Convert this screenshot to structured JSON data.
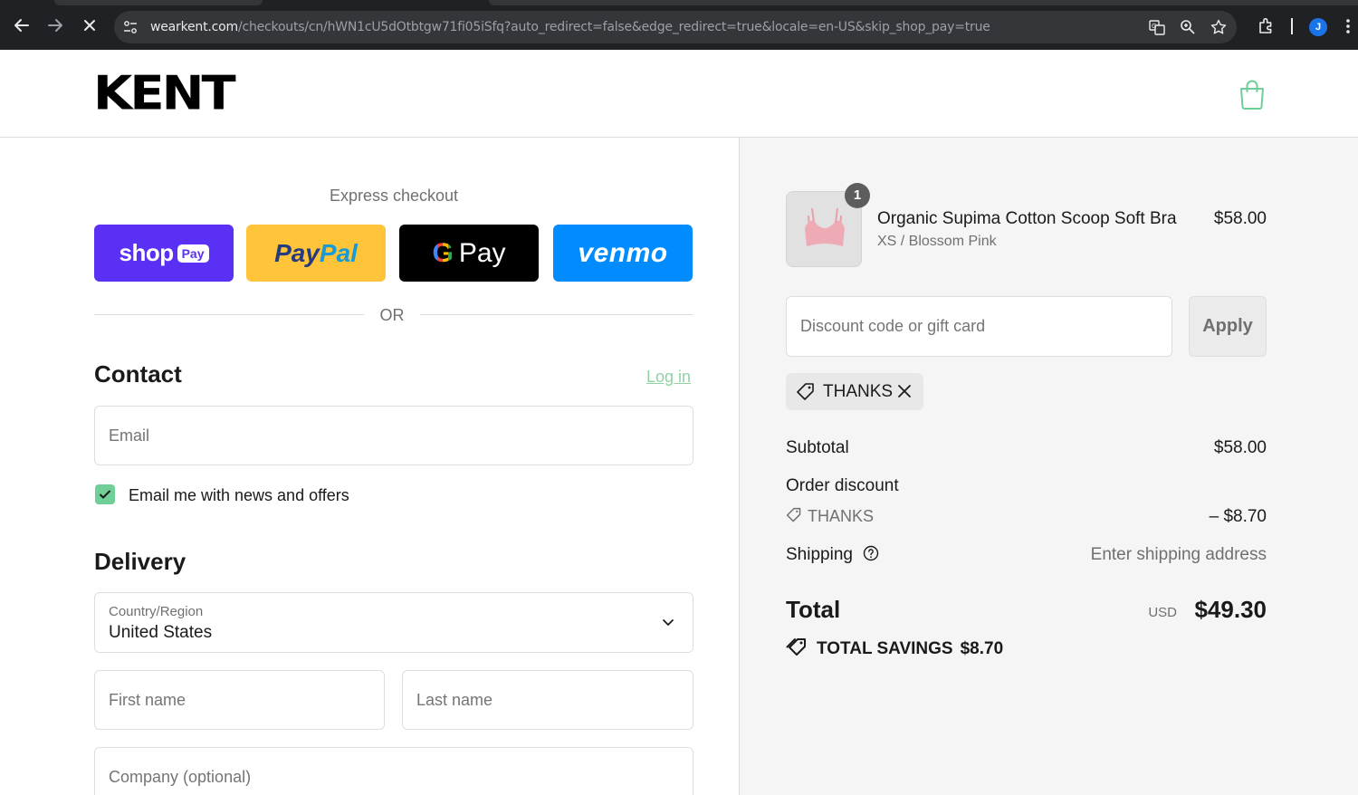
{
  "browser": {
    "url_host": "wearkent.com",
    "url_path": "/checkouts/cn/hWN1cU5dOtbtgw71fi05iSfq?auto_redirect=false&edge_redirect=true&locale=en-US&skip_shop_pay=true",
    "profile_initial": "J"
  },
  "brand": {
    "logo_text": "KENT",
    "accent_color": "#6fcf97"
  },
  "express": {
    "title": "Express checkout",
    "shop_pay": {
      "word": "shop",
      "pill": "Pay"
    },
    "paypal": {
      "part1": "Pay",
      "part2": "Pal"
    },
    "gpay": {
      "g": "G",
      "word": "Pay"
    },
    "venmo": {
      "word": "venmo"
    },
    "or": "OR"
  },
  "contact": {
    "title": "Contact",
    "login": "Log in",
    "email_placeholder": "Email",
    "newsletter_label": "Email me with news and offers",
    "newsletter_checked": true
  },
  "delivery": {
    "title": "Delivery",
    "country_label": "Country/Region",
    "country_value": "United States",
    "first_name_placeholder": "First name",
    "last_name_placeholder": "Last name",
    "company_placeholder": "Company (optional)"
  },
  "cart": {
    "quantity": "1",
    "product_name": "Organic Supima Cotton Scoop Soft Bra",
    "variant": "XS / Blossom Pink",
    "price": "$58.00"
  },
  "discount": {
    "placeholder": "Discount code or gift card",
    "apply": "Apply",
    "applied_code": "THANKS"
  },
  "summary": {
    "subtotal_label": "Subtotal",
    "subtotal_value": "$58.00",
    "order_discount_label": "Order discount",
    "discount_code": "THANKS",
    "discount_value": "– $8.70",
    "shipping_label": "Shipping",
    "shipping_value": "Enter shipping address",
    "total_label": "Total",
    "currency": "USD",
    "total_value": "$49.30",
    "savings_label": "TOTAL SAVINGS",
    "savings_value": "$8.70"
  }
}
